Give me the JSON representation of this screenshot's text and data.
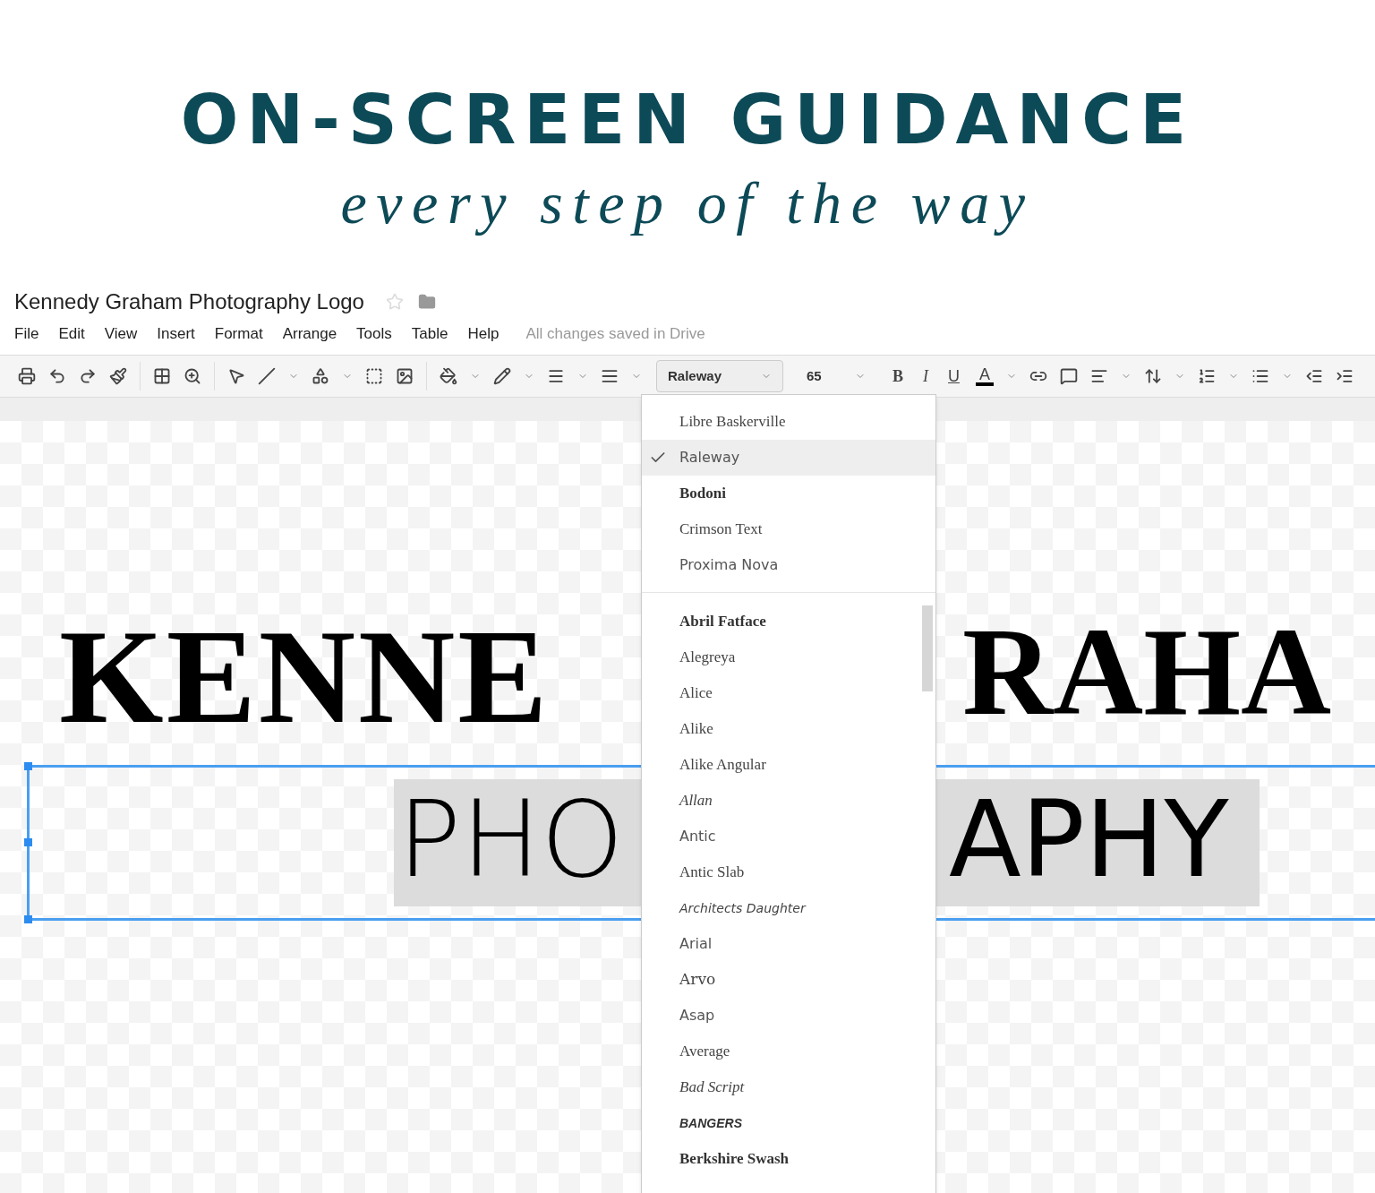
{
  "banner": {
    "headline": "ON-SCREEN GUIDANCE",
    "tagline": "every step of the way"
  },
  "document": {
    "title": "Kennedy Graham Photography Logo",
    "starred": false
  },
  "menu_bar": {
    "items": [
      "File",
      "Edit",
      "View",
      "Insert",
      "Format",
      "Arrange",
      "Tools",
      "Table",
      "Help"
    ],
    "save_status": "All changes saved in Drive"
  },
  "toolbar": {
    "font": "Raleway",
    "font_size": "65",
    "format_buttons": [
      {
        "label": "B",
        "kind": "bold"
      },
      {
        "label": "I",
        "kind": "italic"
      },
      {
        "label": "U",
        "kind": "underline"
      },
      {
        "label": "A",
        "kind": "color"
      }
    ]
  },
  "canvas": {
    "title_left": "KENNE",
    "title_right": "RAHA",
    "subtitle_left": "PHO",
    "subtitle_right": "APHY"
  },
  "font_menu": {
    "recent": [
      {
        "name": "Libre Baskerville",
        "kind": "serif",
        "selected": false
      },
      {
        "name": "Raleway",
        "kind": "sans",
        "selected": true
      },
      {
        "name": "Bodoni",
        "kind": "serif-bold",
        "selected": false
      },
      {
        "name": "Crimson Text",
        "kind": "serif",
        "selected": false
      },
      {
        "name": "Proxima Nova",
        "kind": "sans",
        "selected": false
      }
    ],
    "all": [
      {
        "name": "Abril Fatface",
        "kind": "serif-bold",
        "selected": false
      },
      {
        "name": "Alegreya",
        "kind": "serif",
        "selected": false
      },
      {
        "name": "Alice",
        "kind": "serif",
        "selected": false
      },
      {
        "name": "Alike",
        "kind": "serif",
        "selected": false
      },
      {
        "name": "Alike Angular",
        "kind": "serif",
        "selected": false
      },
      {
        "name": "Allan",
        "kind": "script",
        "selected": false
      },
      {
        "name": "Antic",
        "kind": "sans",
        "selected": false
      },
      {
        "name": "Antic Slab",
        "kind": "serif",
        "selected": false
      },
      {
        "name": "Architects Daughter",
        "kind": "handwriting",
        "selected": false
      },
      {
        "name": "Arial",
        "kind": "sans",
        "selected": false
      },
      {
        "name": "Arvo",
        "kind": "slab",
        "selected": false
      },
      {
        "name": "Asap",
        "kind": "sans",
        "selected": false
      },
      {
        "name": "Average",
        "kind": "serif",
        "selected": false
      },
      {
        "name": "Bad Script",
        "kind": "script",
        "selected": false
      },
      {
        "name": "BANGERS",
        "kind": "display",
        "selected": false
      },
      {
        "name": "Berkshire Swash",
        "kind": "serif-bold",
        "selected": false
      }
    ]
  }
}
